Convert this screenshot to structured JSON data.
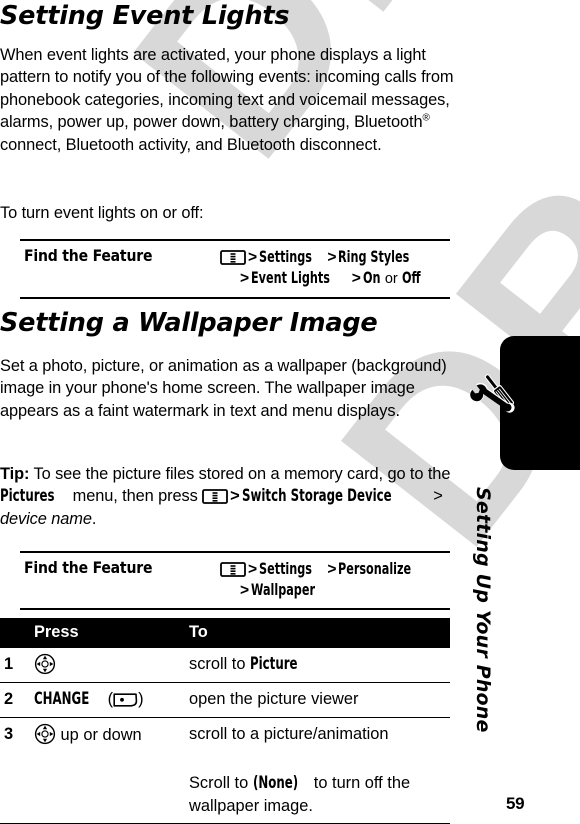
{
  "page": {
    "number": "59",
    "watermark": "DRAFT"
  },
  "chapter_tab": {
    "label": "Setting Up Your Phone",
    "icon": "wrench-screwdriver-icon"
  },
  "sections": [
    {
      "title": "Setting Event Lights",
      "paragraphs": [
        "When event lights are activated, your phone displays a light pattern to notify you of the following events: incoming calls from phonebook categories, incoming text and voicemail messages, alarms, power up, power down, battery charging, Bluetooth® connect, Bluetooth activity, and Bluetooth disconnect.",
        "To turn event lights on or off:"
      ],
      "body_pre_reg": "When event lights are activated, your phone displays a light pattern to notify you of the following events: incoming calls from phonebook categories, incoming text and voicemail messages, alarms, power up, power down, battery charging, Bluetooth",
      "body_reg_mark": "®",
      "body_post_reg": " connect, Bluetooth activity, and Bluetooth disconnect.",
      "intro_line": "To turn event lights on or off:"
    },
    {
      "title": "Setting a Wallpaper Image",
      "paragraph": "Set a photo, picture, or animation as a wallpaper (background) image in your phone's home screen. The wallpaper image appears as a faint watermark in text and menu displays.",
      "tip_label": "Tip:",
      "tip_part1": " To see the picture files stored on a memory card, go to the ",
      "tip_menu": "Pictures",
      "tip_part2": " menu, then press ",
      "tip_action": "Switch Storage Device",
      "tip_part3": " > ",
      "tip_device": "device name",
      "tip_period": "."
    }
  ],
  "find_the_feature_1": {
    "label": "Find the Feature",
    "menu_icon": "menu-key-icon",
    "line1_items": [
      "Settings",
      "Ring Styles"
    ],
    "line2_items": [
      "Event Lights",
      "On",
      "Off"
    ],
    "line1_sep": ">",
    "or_word": "or"
  },
  "find_the_feature_2": {
    "label": "Find the Feature",
    "menu_icon": "menu-key-icon",
    "line1_items": [
      "Settings",
      "Personalize"
    ],
    "line2_items": [
      "Wallpaper"
    ],
    "line1_sep": ">"
  },
  "steps_table": {
    "headers": {
      "num": "",
      "press": "Press",
      "to": "To"
    },
    "rows": [
      {
        "num": "1",
        "press_icon": "nav-key-icon",
        "press_text": "",
        "to_plain": "scroll to ",
        "to_screen": "Picture",
        "to_tail": ""
      },
      {
        "num": "2",
        "press_icon": "soft-key-icon",
        "press_label": "CHANGE",
        "press_paren_open": "(",
        "press_paren_close": ")",
        "to_plain": "open the picture viewer",
        "to_screen": "",
        "to_tail": ""
      },
      {
        "num": "3",
        "press_icon": "nav-key-icon",
        "press_text": " up or down",
        "to_plain": "scroll to a picture/animation",
        "to_screen": "",
        "to_tail": "",
        "sub_plain_1": "Scroll to ",
        "sub_screen": "(None)",
        "sub_plain_2": " to turn off the wallpaper image."
      }
    ]
  },
  "colors": {
    "text": "#000000",
    "header_bar": "#000000",
    "watermark": "#d8d8d8",
    "page_background": "#ffffff"
  }
}
